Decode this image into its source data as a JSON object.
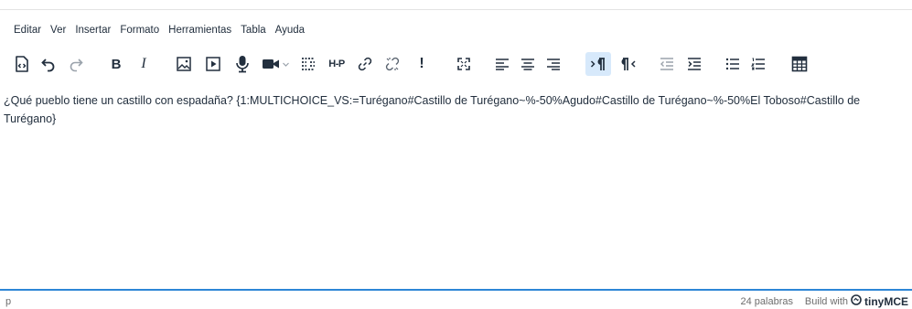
{
  "menubar": {
    "items": [
      "Editar",
      "Ver",
      "Insertar",
      "Formato",
      "Herramientas",
      "Tabla",
      "Ayuda"
    ]
  },
  "toolbar": {
    "bold_label": "B",
    "italic_label": "I",
    "h5p_label": "H-P",
    "exclamation_label": "!",
    "active_button": "ltr",
    "active_color": "#d7e9fb",
    "icons": [
      "source-code-icon",
      "undo-icon",
      "redo-icon",
      "bold-icon",
      "italic-icon",
      "image-icon",
      "media-icon",
      "microphone-icon",
      "video-camera-icon",
      "chevron-down-icon",
      "screen-reader-icon",
      "h5p-icon",
      "link-icon",
      "unlink-icon",
      "exclamation-icon",
      "fullscreen-icon",
      "align-left-icon",
      "align-center-icon",
      "align-right-icon",
      "ltr-icon",
      "rtl-icon",
      "outdent-icon",
      "indent-icon",
      "bullet-list-icon",
      "numbered-list-icon",
      "calculator-icon"
    ]
  },
  "content": {
    "text": "¿Qué pueblo tiene un castillo con espadaña? {1:MULTICHOICE_VS:=Turégano#Castillo de Turégano~%-50%Agudo#Castillo de Turégano~%-50%El Toboso#Castillo de Turégano}"
  },
  "statusbar": {
    "path": "p",
    "word_count": "24 palabras",
    "build_text": "Build with",
    "brand": "tinyMCE",
    "accent_color": "#2d86d6"
  }
}
